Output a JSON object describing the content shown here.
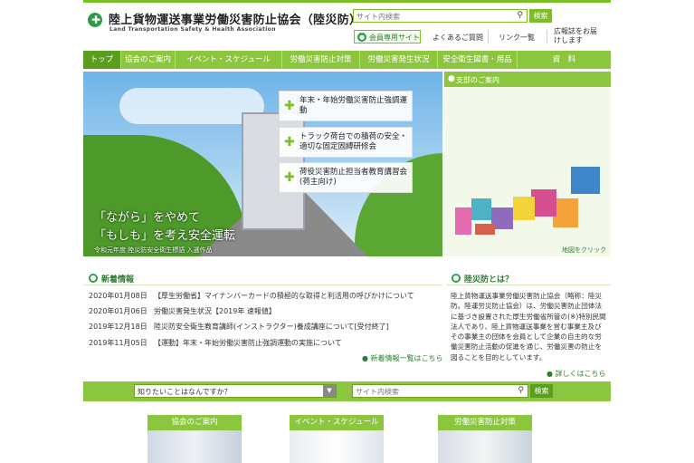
{
  "header": {
    "org_name": "陸上貨物運送事業労働災害防止協会（陸災防）",
    "org_name_en": "Land Transportation Safety & Health Association",
    "search_placeholder": "サイト内検索",
    "search_button": "検索",
    "member_button": "会員専用サイト",
    "faq": "よくあるご質問",
    "links": "リンク一覧",
    "pr_magazine": "広報誌をお届けします"
  },
  "nav": {
    "items": [
      "トップ",
      "協会のご案内",
      "イベント・スケジュール",
      "労働災害防止対策",
      "労働災害発生状況",
      "安全衛生図書・用品",
      "資　料"
    ]
  },
  "hero": {
    "caption_line1": "「ながら」をやめて",
    "caption_line2": "「もしも」を考え安全運転",
    "credit": "令和元年度 陸災防安全衛生標語 入選作品"
  },
  "promos": [
    {
      "label": "年末・年始労働災害防止強調運動"
    },
    {
      "label": "トラック荷台での積荷の安全・適切な固定固縛研修会"
    },
    {
      "label": "荷役災害防止担当者教育講習会(荷主向け)"
    }
  ],
  "branch": {
    "title": "支部のご案内",
    "map_link": "地図をクリック",
    "colors": {
      "hokkaido": "#3f86c9",
      "tohoku": "#f3a33a",
      "kanto": "#d44f8e",
      "chubu": "#f2d33a",
      "kinki": "#8e6bbd",
      "chugoku": "#4db3c4",
      "shikoku": "#d8604b",
      "kyushu": "#e36cb0"
    }
  },
  "news": {
    "title": "新着情報",
    "items": [
      {
        "date": "2020年01月08日",
        "text": "【厚生労働省】マイナンバーカードの積極的な取得と利活用の呼びかけについて"
      },
      {
        "date": "2020年01月06日",
        "text": "労働災害発生状況【2019年 速報値】"
      },
      {
        "date": "2019年12月18日",
        "text": "陸災防安全衛生教育講師(インストラクター)養成講座について[受付終了]"
      },
      {
        "date": "2019年11月05日",
        "text": "【運動】年末・年始労働災害防止強調運動の実施について"
      }
    ],
    "more": "新着情報一覧はこちら"
  },
  "about": {
    "title": "陸災防とは？",
    "text": "陸上貨物運送事業労働災害防止協会（略称：陸災防。陸運労災防止協会）は、労働災害防止団体法に基づき設置された厚生労働省所管の(※)特別民間法人であり、陸上貨物運送事業を営む事業主及びその事業主の団体を会員として企業の自主的な労働災害防止活動の促進を通じ、労働災害の防止を図ることを目的としています。",
    "more": "詳しくはこちら"
  },
  "bottom_search": {
    "ask_label": "知りたいことはなんですか？",
    "placeholder": "サイト内検索",
    "button": "検索"
  },
  "cards": [
    {
      "label": "協会のご案内"
    },
    {
      "label": "イベント・スケジュール"
    },
    {
      "label": "労働災害防止対策"
    }
  ],
  "colors": {
    "accent": "#8cc63f",
    "accent_dark": "#5a9e1e",
    "brand_green": "#2e9b45"
  }
}
